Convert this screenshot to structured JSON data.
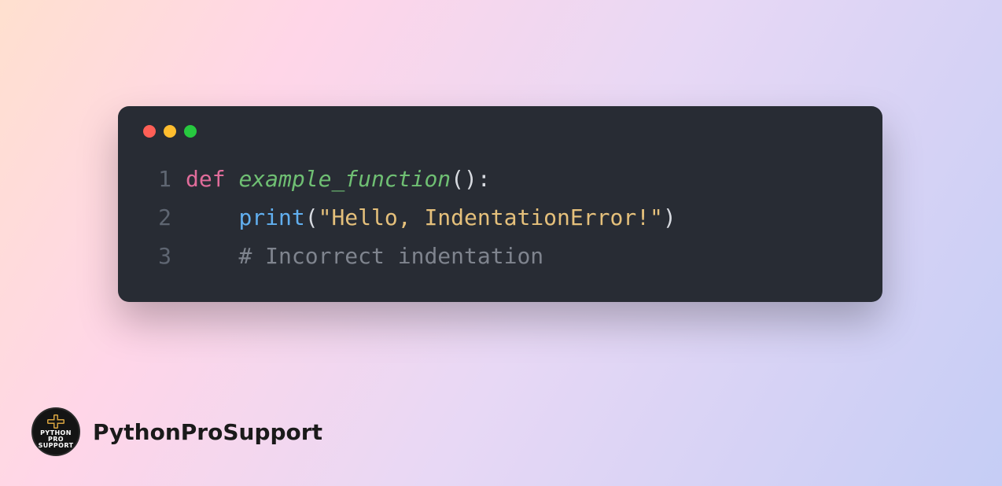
{
  "brand": "PythonProSupport",
  "logo": {
    "line1": "PYTHON PRO",
    "line2": "SUPPORT"
  },
  "code": {
    "lines": [
      {
        "n": "1",
        "segments": [
          {
            "cls": "kw",
            "t": "def "
          },
          {
            "cls": "fn",
            "t": "example_function"
          },
          {
            "cls": "tok",
            "t": "():"
          }
        ]
      },
      {
        "n": "2",
        "segments": [
          {
            "cls": "tok",
            "t": "    "
          },
          {
            "cls": "call",
            "t": "print"
          },
          {
            "cls": "tok",
            "t": "("
          },
          {
            "cls": "str",
            "t": "\"Hello, IndentationError!\""
          },
          {
            "cls": "tok",
            "t": ")"
          }
        ]
      },
      {
        "n": "3",
        "segments": [
          {
            "cls": "tok",
            "t": "    "
          },
          {
            "cls": "cmt",
            "t": "# Incorrect indentation"
          }
        ]
      }
    ]
  }
}
